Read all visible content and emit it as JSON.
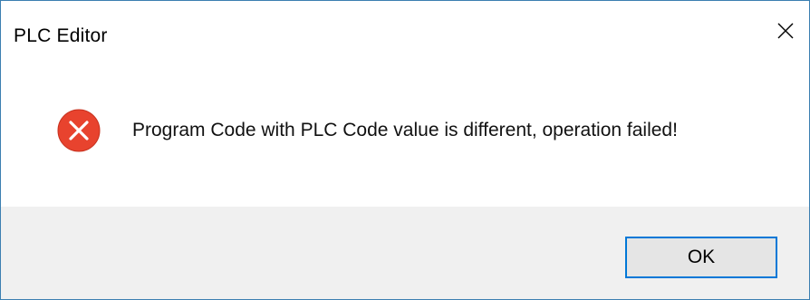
{
  "window": {
    "title": "PLC Editor"
  },
  "message": {
    "text": "Program Code with PLC Code value is different, operation failed!",
    "icon": "error-icon"
  },
  "buttons": {
    "ok_label": "OK"
  },
  "icons": {
    "close": "close-icon"
  },
  "colors": {
    "window_border": "#3c7fb1",
    "error_red": "#e8432e",
    "button_focus_border": "#0078d7",
    "footer_background": "#f0f0f0"
  }
}
